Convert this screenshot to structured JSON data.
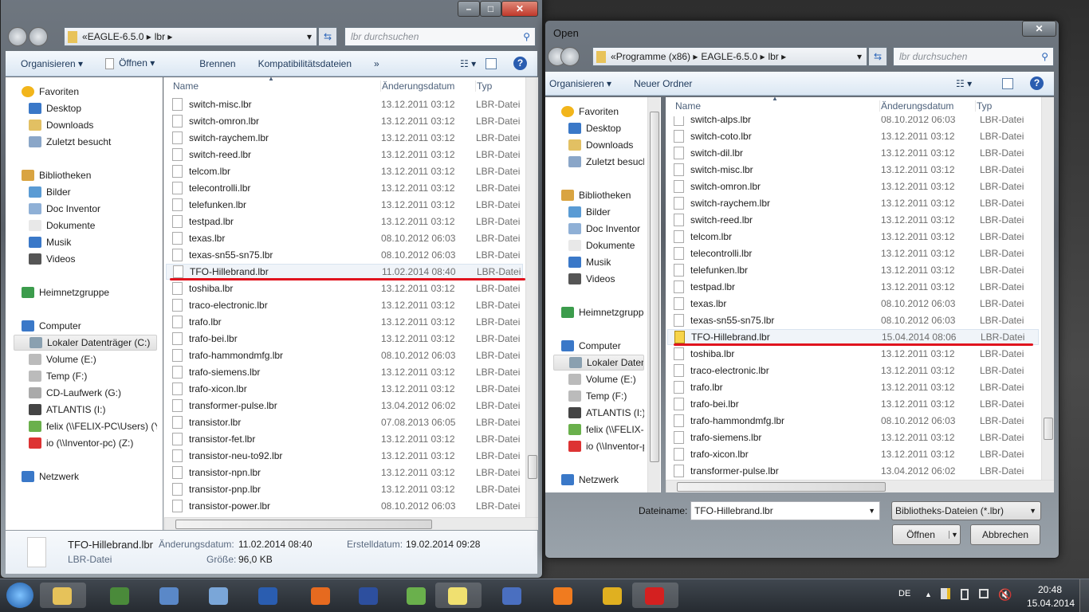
{
  "left_window": {
    "address": {
      "prefix": "«",
      "segments": [
        "EAGLE-6.5.0",
        "lbr"
      ]
    },
    "search_placeholder": "lbr durchsuchen",
    "toolbar": {
      "organize": "Organisieren ▾",
      "open": "Öffnen ▾",
      "burn": "Brennen",
      "compat": "Kompatibilitätsdateien",
      "more": "»"
    },
    "columns": {
      "name": "Name",
      "date": "Änderungsdatum",
      "type": "Typ"
    },
    "nav": [
      {
        "label": "Favoriten",
        "icon": "star-icon",
        "level": 0
      },
      {
        "label": "Desktop",
        "icon": "desktop-icon",
        "level": 1
      },
      {
        "label": "Downloads",
        "icon": "downloads-folder-icon",
        "level": 1
      },
      {
        "label": "Zuletzt besucht",
        "icon": "recent-places-icon",
        "level": 1
      },
      {
        "label": "Bibliotheken",
        "icon": "libraries-icon",
        "level": 0,
        "gap": 1
      },
      {
        "label": "Bilder",
        "icon": "pictures-icon",
        "level": 1
      },
      {
        "label": "Doc Inventor",
        "icon": "library-icon",
        "level": 1
      },
      {
        "label": "Dokumente",
        "icon": "documents-icon",
        "level": 1
      },
      {
        "label": "Musik",
        "icon": "music-icon",
        "level": 1
      },
      {
        "label": "Videos",
        "icon": "videos-icon",
        "level": 1
      },
      {
        "label": "Heimnetzgruppe",
        "icon": "homegroup-icon",
        "level": 0,
        "gap": 1
      },
      {
        "label": "Computer",
        "icon": "computer-icon",
        "level": 0,
        "gap": 1
      },
      {
        "label": "Lokaler Datenträger (C:)",
        "icon": "system-drive-icon",
        "level": 1,
        "selected": true
      },
      {
        "label": "Volume (E:)",
        "icon": "drive-icon",
        "level": 1
      },
      {
        "label": "Temp (F:)",
        "icon": "drive-icon",
        "level": 1
      },
      {
        "label": "CD-Laufwerk (G:)",
        "icon": "cd-drive-icon",
        "level": 1
      },
      {
        "label": "ATLANTIS (I:)",
        "icon": "removable-drive-icon",
        "level": 1
      },
      {
        "label": "felix (\\\\FELIX-PC\\Users) (Y:)",
        "icon": "network-drive-icon",
        "level": 1
      },
      {
        "label": "io (\\\\Inventor-pc) (Z:)",
        "icon": "disconnected-drive-icon",
        "level": 1
      },
      {
        "label": "Netzwerk",
        "icon": "network-icon",
        "level": 0,
        "gap": 1
      }
    ],
    "files": [
      {
        "name": "switch-misc.lbr",
        "date": "13.12.2011 03:12",
        "type": "LBR-Datei"
      },
      {
        "name": "switch-omron.lbr",
        "date": "13.12.2011 03:12",
        "type": "LBR-Datei"
      },
      {
        "name": "switch-raychem.lbr",
        "date": "13.12.2011 03:12",
        "type": "LBR-Datei"
      },
      {
        "name": "switch-reed.lbr",
        "date": "13.12.2011 03:12",
        "type": "LBR-Datei"
      },
      {
        "name": "telcom.lbr",
        "date": "13.12.2011 03:12",
        "type": "LBR-Datei"
      },
      {
        "name": "telecontrolli.lbr",
        "date": "13.12.2011 03:12",
        "type": "LBR-Datei"
      },
      {
        "name": "telefunken.lbr",
        "date": "13.12.2011 03:12",
        "type": "LBR-Datei"
      },
      {
        "name": "testpad.lbr",
        "date": "13.12.2011 03:12",
        "type": "LBR-Datei"
      },
      {
        "name": "texas.lbr",
        "date": "08.10.2012 06:03",
        "type": "LBR-Datei"
      },
      {
        "name": "texas-sn55-sn75.lbr",
        "date": "08.10.2012 06:03",
        "type": "LBR-Datei"
      },
      {
        "name": "TFO-Hillebrand.lbr",
        "date": "11.02.2014 08:40",
        "type": "LBR-Datei",
        "selected": true
      },
      {
        "name": "toshiba.lbr",
        "date": "13.12.2011 03:12",
        "type": "LBR-Datei"
      },
      {
        "name": "traco-electronic.lbr",
        "date": "13.12.2011 03:12",
        "type": "LBR-Datei"
      },
      {
        "name": "trafo.lbr",
        "date": "13.12.2011 03:12",
        "type": "LBR-Datei"
      },
      {
        "name": "trafo-bei.lbr",
        "date": "13.12.2011 03:12",
        "type": "LBR-Datei"
      },
      {
        "name": "trafo-hammondmfg.lbr",
        "date": "08.10.2012 06:03",
        "type": "LBR-Datei"
      },
      {
        "name": "trafo-siemens.lbr",
        "date": "13.12.2011 03:12",
        "type": "LBR-Datei"
      },
      {
        "name": "trafo-xicon.lbr",
        "date": "13.12.2011 03:12",
        "type": "LBR-Datei"
      },
      {
        "name": "transformer-pulse.lbr",
        "date": "13.04.2012 06:02",
        "type": "LBR-Datei"
      },
      {
        "name": "transistor.lbr",
        "date": "07.08.2013 06:05",
        "type": "LBR-Datei"
      },
      {
        "name": "transistor-fet.lbr",
        "date": "13.12.2011 03:12",
        "type": "LBR-Datei"
      },
      {
        "name": "transistor-neu-to92.lbr",
        "date": "13.12.2011 03:12",
        "type": "LBR-Datei"
      },
      {
        "name": "transistor-npn.lbr",
        "date": "13.12.2011 03:12",
        "type": "LBR-Datei"
      },
      {
        "name": "transistor-pnp.lbr",
        "date": "13.12.2011 03:12",
        "type": "LBR-Datei"
      },
      {
        "name": "transistor-power.lbr",
        "date": "08.10.2012 06:03",
        "type": "LBR-Datei"
      }
    ],
    "details": {
      "name": "TFO-Hillebrand.lbr",
      "type": "LBR-Datei",
      "modified_label": "Änderungsdatum:",
      "modified": "11.02.2014 08:40",
      "created_label": "Erstelldatum:",
      "created": "19.02.2014 09:28",
      "size_label": "Größe:",
      "size": "96,0 KB"
    }
  },
  "right_window": {
    "title": "Open",
    "address": {
      "prefix": "«",
      "segments": [
        "Programme (x86)",
        "EAGLE-6.5.0",
        "lbr"
      ]
    },
    "search_placeholder": "lbr durchsuchen",
    "toolbar": {
      "organize": "Organisieren ▾",
      "new_folder": "Neuer Ordner"
    },
    "columns": {
      "name": "Name",
      "date": "Änderungsdatum",
      "type": "Typ"
    },
    "nav": [
      {
        "label": "Favoriten",
        "icon": "star-icon",
        "level": 0
      },
      {
        "label": "Desktop",
        "icon": "desktop-icon",
        "level": 1
      },
      {
        "label": "Downloads",
        "icon": "downloads-folder-icon",
        "level": 1
      },
      {
        "label": "Zuletzt besucht",
        "icon": "recent-places-icon",
        "level": 1
      },
      {
        "label": "Bibliotheken",
        "icon": "libraries-icon",
        "level": 0,
        "gap": 1
      },
      {
        "label": "Bilder",
        "icon": "pictures-icon",
        "level": 1
      },
      {
        "label": "Doc Inventor",
        "icon": "library-icon",
        "level": 1
      },
      {
        "label": "Dokumente",
        "icon": "documents-icon",
        "level": 1
      },
      {
        "label": "Musik",
        "icon": "music-icon",
        "level": 1
      },
      {
        "label": "Videos",
        "icon": "videos-icon",
        "level": 1
      },
      {
        "label": "Heimnetzgruppe",
        "icon": "homegroup-icon",
        "level": 0,
        "gap": 1
      },
      {
        "label": "Computer",
        "icon": "computer-icon",
        "level": 0,
        "gap": 1
      },
      {
        "label": "Lokaler Datenträger (C:)",
        "icon": "system-drive-icon",
        "level": 1,
        "selected": true
      },
      {
        "label": "Volume (E:)",
        "icon": "drive-icon",
        "level": 1
      },
      {
        "label": "Temp (F:)",
        "icon": "drive-icon",
        "level": 1
      },
      {
        "label": "ATLANTIS (I:)",
        "icon": "removable-drive-icon",
        "level": 1
      },
      {
        "label": "felix (\\\\FELIX-PC\\Users) (Y:)",
        "icon": "network-drive-icon",
        "level": 1
      },
      {
        "label": "io (\\\\Inventor-pc) (Z:)",
        "icon": "disconnected-drive-icon",
        "level": 1
      },
      {
        "label": "Netzwerk",
        "icon": "network-icon",
        "level": 0,
        "gap": 1
      }
    ],
    "files": [
      {
        "name": "switch-alps.lbr",
        "date": "08.10.2012 06:03",
        "type": "LBR-Datei"
      },
      {
        "name": "switch-coto.lbr",
        "date": "13.12.2011 03:12",
        "type": "LBR-Datei"
      },
      {
        "name": "switch-dil.lbr",
        "date": "13.12.2011 03:12",
        "type": "LBR-Datei"
      },
      {
        "name": "switch-misc.lbr",
        "date": "13.12.2011 03:12",
        "type": "LBR-Datei"
      },
      {
        "name": "switch-omron.lbr",
        "date": "13.12.2011 03:12",
        "type": "LBR-Datei"
      },
      {
        "name": "switch-raychem.lbr",
        "date": "13.12.2011 03:12",
        "type": "LBR-Datei"
      },
      {
        "name": "switch-reed.lbr",
        "date": "13.12.2011 03:12",
        "type": "LBR-Datei"
      },
      {
        "name": "telcom.lbr",
        "date": "13.12.2011 03:12",
        "type": "LBR-Datei"
      },
      {
        "name": "telecontrolli.lbr",
        "date": "13.12.2011 03:12",
        "type": "LBR-Datei"
      },
      {
        "name": "telefunken.lbr",
        "date": "13.12.2011 03:12",
        "type": "LBR-Datei"
      },
      {
        "name": "testpad.lbr",
        "date": "13.12.2011 03:12",
        "type": "LBR-Datei"
      },
      {
        "name": "texas.lbr",
        "date": "08.10.2012 06:03",
        "type": "LBR-Datei"
      },
      {
        "name": "texas-sn55-sn75.lbr",
        "date": "08.10.2012 06:03",
        "type": "LBR-Datei"
      },
      {
        "name": "TFO-Hillebrand.lbr",
        "date": "15.04.2014 08:06",
        "type": "LBR-Datei",
        "selected": true,
        "locked": true
      },
      {
        "name": "toshiba.lbr",
        "date": "13.12.2011 03:12",
        "type": "LBR-Datei"
      },
      {
        "name": "traco-electronic.lbr",
        "date": "13.12.2011 03:12",
        "type": "LBR-Datei"
      },
      {
        "name": "trafo.lbr",
        "date": "13.12.2011 03:12",
        "type": "LBR-Datei"
      },
      {
        "name": "trafo-bei.lbr",
        "date": "13.12.2011 03:12",
        "type": "LBR-Datei"
      },
      {
        "name": "trafo-hammondmfg.lbr",
        "date": "08.10.2012 06:03",
        "type": "LBR-Datei"
      },
      {
        "name": "trafo-siemens.lbr",
        "date": "13.12.2011 03:12",
        "type": "LBR-Datei"
      },
      {
        "name": "trafo-xicon.lbr",
        "date": "13.12.2011 03:12",
        "type": "LBR-Datei"
      },
      {
        "name": "transformer-pulse.lbr",
        "date": "13.04.2012 06:02",
        "type": "LBR-Datei"
      }
    ],
    "filename_label": "Dateiname:",
    "filename_value": "TFO-Hillebrand.lbr",
    "filter_value": "Bibliotheks-Dateien (*.lbr)",
    "open_button": "Öffnen",
    "cancel_button": "Abbrechen"
  },
  "taskbar": {
    "apps": [
      "start-orb",
      "windows-explorer",
      "system-monitor",
      "task-scheduler",
      "calculator",
      "installer",
      "firefox",
      "visual-studio",
      "csharp-ide",
      "sticky-notes",
      "paint-tool",
      "origin-app",
      "chrome",
      "eagle"
    ],
    "language": "DE",
    "time": "20:48",
    "date": "15.04.2014"
  },
  "colors": {
    "highlight_underline": "#e0141e",
    "selection": "#f0f4f9"
  }
}
